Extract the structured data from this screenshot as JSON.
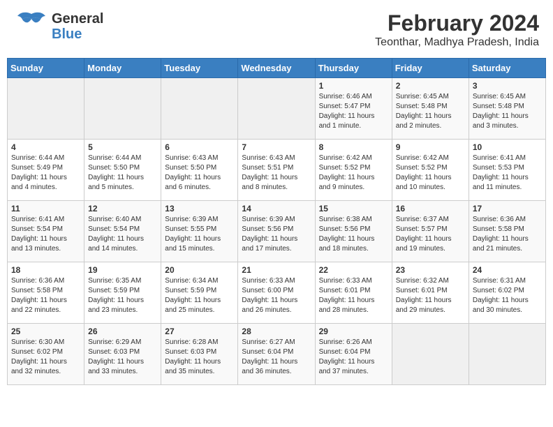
{
  "header": {
    "logo_text_general": "General",
    "logo_text_blue": "Blue",
    "month_year": "February 2024",
    "location": "Teonthar, Madhya Pradesh, India"
  },
  "days_of_week": [
    "Sunday",
    "Monday",
    "Tuesday",
    "Wednesday",
    "Thursday",
    "Friday",
    "Saturday"
  ],
  "weeks": [
    [
      {
        "day": "",
        "info": ""
      },
      {
        "day": "",
        "info": ""
      },
      {
        "day": "",
        "info": ""
      },
      {
        "day": "",
        "info": ""
      },
      {
        "day": "1",
        "info": "Sunrise: 6:46 AM\nSunset: 5:47 PM\nDaylight: 11 hours and 1 minute."
      },
      {
        "day": "2",
        "info": "Sunrise: 6:45 AM\nSunset: 5:48 PM\nDaylight: 11 hours and 2 minutes."
      },
      {
        "day": "3",
        "info": "Sunrise: 6:45 AM\nSunset: 5:48 PM\nDaylight: 11 hours and 3 minutes."
      }
    ],
    [
      {
        "day": "4",
        "info": "Sunrise: 6:44 AM\nSunset: 5:49 PM\nDaylight: 11 hours and 4 minutes."
      },
      {
        "day": "5",
        "info": "Sunrise: 6:44 AM\nSunset: 5:50 PM\nDaylight: 11 hours and 5 minutes."
      },
      {
        "day": "6",
        "info": "Sunrise: 6:43 AM\nSunset: 5:50 PM\nDaylight: 11 hours and 6 minutes."
      },
      {
        "day": "7",
        "info": "Sunrise: 6:43 AM\nSunset: 5:51 PM\nDaylight: 11 hours and 8 minutes."
      },
      {
        "day": "8",
        "info": "Sunrise: 6:42 AM\nSunset: 5:52 PM\nDaylight: 11 hours and 9 minutes."
      },
      {
        "day": "9",
        "info": "Sunrise: 6:42 AM\nSunset: 5:52 PM\nDaylight: 11 hours and 10 minutes."
      },
      {
        "day": "10",
        "info": "Sunrise: 6:41 AM\nSunset: 5:53 PM\nDaylight: 11 hours and 11 minutes."
      }
    ],
    [
      {
        "day": "11",
        "info": "Sunrise: 6:41 AM\nSunset: 5:54 PM\nDaylight: 11 hours and 13 minutes."
      },
      {
        "day": "12",
        "info": "Sunrise: 6:40 AM\nSunset: 5:54 PM\nDaylight: 11 hours and 14 minutes."
      },
      {
        "day": "13",
        "info": "Sunrise: 6:39 AM\nSunset: 5:55 PM\nDaylight: 11 hours and 15 minutes."
      },
      {
        "day": "14",
        "info": "Sunrise: 6:39 AM\nSunset: 5:56 PM\nDaylight: 11 hours and 17 minutes."
      },
      {
        "day": "15",
        "info": "Sunrise: 6:38 AM\nSunset: 5:56 PM\nDaylight: 11 hours and 18 minutes."
      },
      {
        "day": "16",
        "info": "Sunrise: 6:37 AM\nSunset: 5:57 PM\nDaylight: 11 hours and 19 minutes."
      },
      {
        "day": "17",
        "info": "Sunrise: 6:36 AM\nSunset: 5:58 PM\nDaylight: 11 hours and 21 minutes."
      }
    ],
    [
      {
        "day": "18",
        "info": "Sunrise: 6:36 AM\nSunset: 5:58 PM\nDaylight: 11 hours and 22 minutes."
      },
      {
        "day": "19",
        "info": "Sunrise: 6:35 AM\nSunset: 5:59 PM\nDaylight: 11 hours and 23 minutes."
      },
      {
        "day": "20",
        "info": "Sunrise: 6:34 AM\nSunset: 5:59 PM\nDaylight: 11 hours and 25 minutes."
      },
      {
        "day": "21",
        "info": "Sunrise: 6:33 AM\nSunset: 6:00 PM\nDaylight: 11 hours and 26 minutes."
      },
      {
        "day": "22",
        "info": "Sunrise: 6:33 AM\nSunset: 6:01 PM\nDaylight: 11 hours and 28 minutes."
      },
      {
        "day": "23",
        "info": "Sunrise: 6:32 AM\nSunset: 6:01 PM\nDaylight: 11 hours and 29 minutes."
      },
      {
        "day": "24",
        "info": "Sunrise: 6:31 AM\nSunset: 6:02 PM\nDaylight: 11 hours and 30 minutes."
      }
    ],
    [
      {
        "day": "25",
        "info": "Sunrise: 6:30 AM\nSunset: 6:02 PM\nDaylight: 11 hours and 32 minutes."
      },
      {
        "day": "26",
        "info": "Sunrise: 6:29 AM\nSunset: 6:03 PM\nDaylight: 11 hours and 33 minutes."
      },
      {
        "day": "27",
        "info": "Sunrise: 6:28 AM\nSunset: 6:03 PM\nDaylight: 11 hours and 35 minutes."
      },
      {
        "day": "28",
        "info": "Sunrise: 6:27 AM\nSunset: 6:04 PM\nDaylight: 11 hours and 36 minutes."
      },
      {
        "day": "29",
        "info": "Sunrise: 6:26 AM\nSunset: 6:04 PM\nDaylight: 11 hours and 37 minutes."
      },
      {
        "day": "",
        "info": ""
      },
      {
        "day": "",
        "info": ""
      }
    ]
  ]
}
